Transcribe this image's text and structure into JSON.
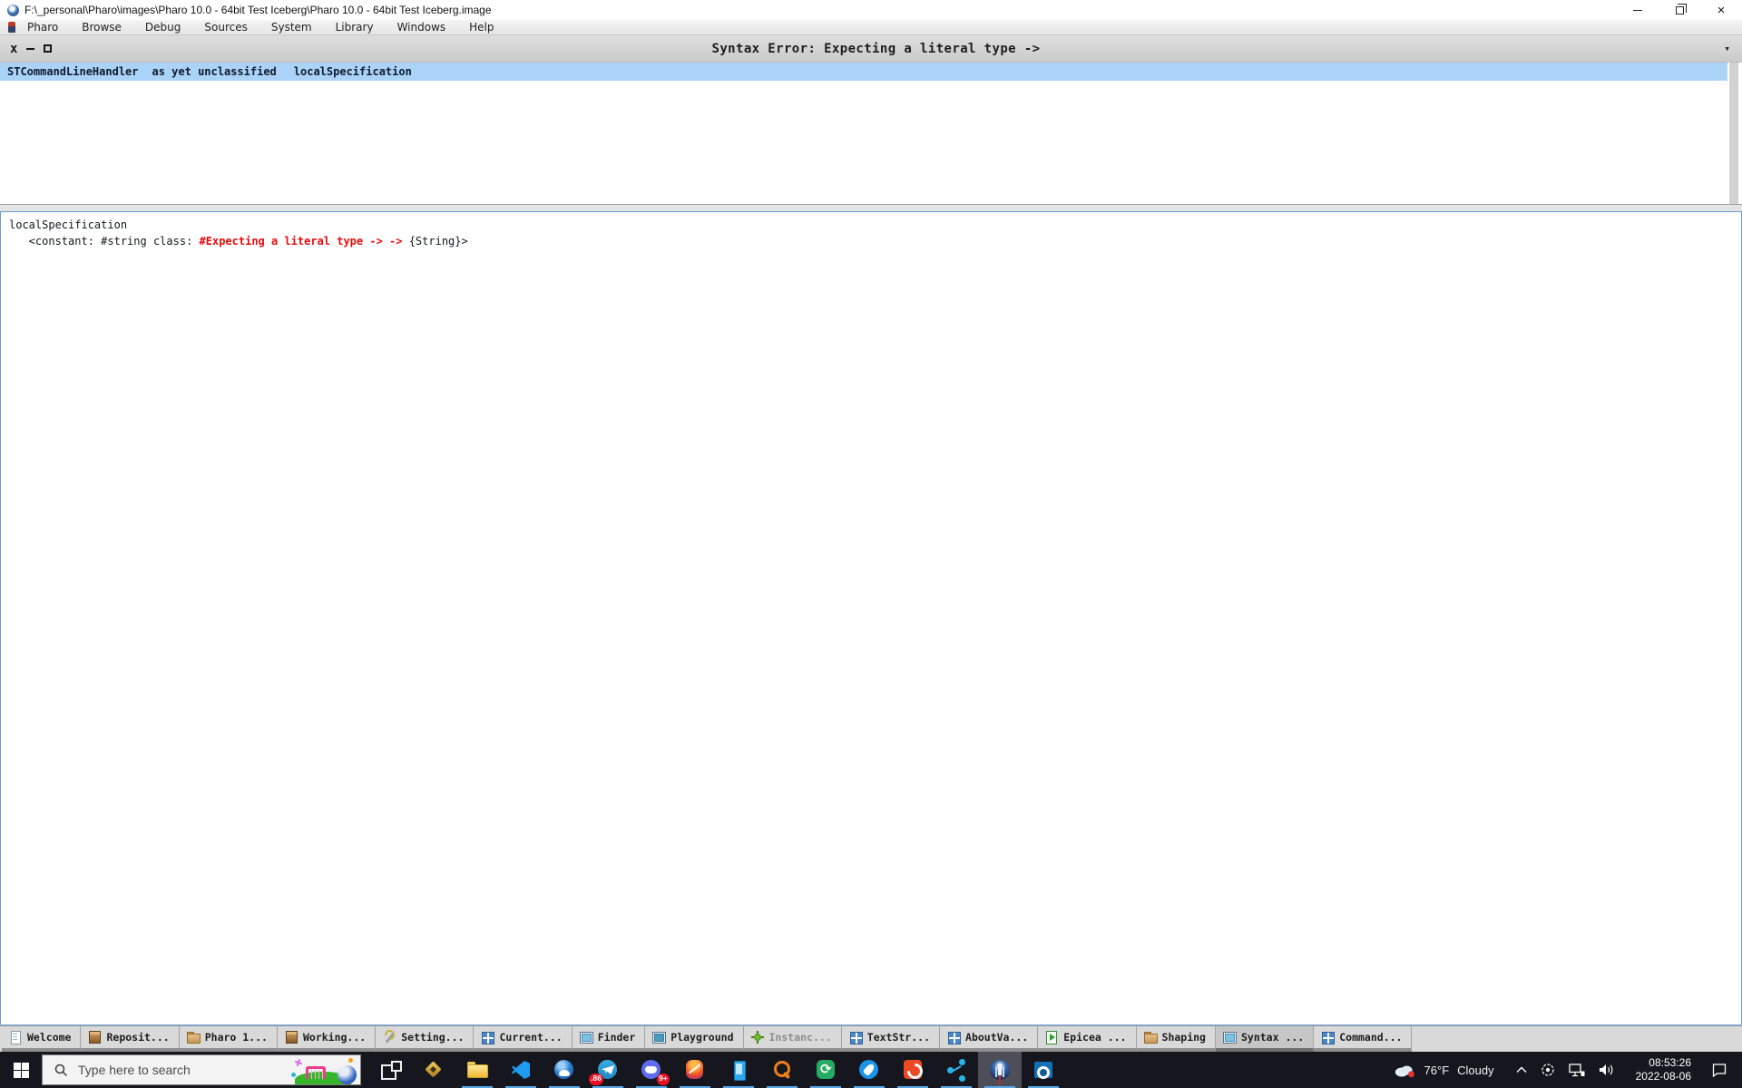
{
  "colors": {
    "selection_blue": "#abd2f7",
    "error_red": "#e50b0b",
    "code_pane_border": "#6a9ad2",
    "windows_taskbar_bg": "#16161f",
    "running_indicator_blue": "#5aa8e8",
    "badge_red": "#e81123"
  },
  "windows_titlebar": {
    "title": "F:\\_personal\\Pharo\\images\\Pharo 10.0 - 64bit Test Iceberg\\Pharo 10.0 - 64bit Test Iceberg.image"
  },
  "menu": {
    "items": [
      {
        "label": "Pharo"
      },
      {
        "label": "Browse"
      },
      {
        "label": "Debug"
      },
      {
        "label": "Sources"
      },
      {
        "label": "System"
      },
      {
        "label": "Library"
      },
      {
        "label": "Windows"
      },
      {
        "label": "Help"
      }
    ]
  },
  "syntax_window": {
    "close_glyph": "x",
    "chevron_glyph": "▾",
    "title": "Syntax Error: Expecting a literal type ->",
    "selected_row": {
      "class_name": "STCommandLineHandler",
      "protocol": "as yet unclassified",
      "selector": "localSpecification"
    },
    "code": {
      "line1": "localSpecification",
      "line2_pre": "   <constant: #string class: ",
      "line2_error": "#Expecting a literal type -> ->",
      "line2_post": " {String}>"
    }
  },
  "pharo_taskbar": {
    "buttons": [
      {
        "name": "welcome",
        "label": "Welcome",
        "icon": "welcome"
      },
      {
        "name": "repositories",
        "label": "Reposit...",
        "icon": "package"
      },
      {
        "name": "pharo-folder",
        "label": "Pharo 1...",
        "icon": "folder"
      },
      {
        "name": "working-copy",
        "label": "Working...",
        "icon": "package"
      },
      {
        "name": "settings",
        "label": "Setting...",
        "icon": "settings"
      },
      {
        "name": "current",
        "label": "Current...",
        "icon": "grid"
      },
      {
        "name": "finder",
        "label": "Finder",
        "icon": "window"
      },
      {
        "name": "playground",
        "label": "Playground",
        "icon": "playground"
      },
      {
        "name": "instance",
        "label": "Instanc...",
        "icon": "bug",
        "dimmed": true
      },
      {
        "name": "textstring",
        "label": "TextStr...",
        "icon": "grid"
      },
      {
        "name": "aboutvalue",
        "label": "AboutVa...",
        "icon": "grid"
      },
      {
        "name": "epicea",
        "label": "Epicea ...",
        "icon": "epicea"
      },
      {
        "name": "shaping",
        "label": "Shaping",
        "icon": "folder"
      },
      {
        "name": "syntax-error",
        "label": "Syntax ...",
        "icon": "window",
        "active": true
      },
      {
        "name": "command",
        "label": "Command...",
        "icon": "grid"
      }
    ]
  },
  "windows_taskbar": {
    "search_placeholder": "Type here to search",
    "app_icons": [
      {
        "name": "task-view",
        "icon": "task-view",
        "running": false
      },
      {
        "name": "compass",
        "icon": "compass",
        "running": false
      },
      {
        "name": "file-explorer",
        "icon": "explorer",
        "running": true
      },
      {
        "name": "vscode",
        "icon": "vscode",
        "running": true
      },
      {
        "name": "browser",
        "icon": "browser",
        "running": true
      },
      {
        "name": "telegram",
        "icon": "telegram",
        "running": true,
        "badge": ".86",
        "badge_side": "left"
      },
      {
        "name": "discord",
        "icon": "discord",
        "running": true,
        "badge": "9+",
        "badge_side": "right"
      },
      {
        "name": "monkey-app",
        "icon": "monkey",
        "running": true
      },
      {
        "name": "your-phone",
        "icon": "your-phone",
        "running": true
      },
      {
        "name": "search-app",
        "icon": "search-orange",
        "running": true
      },
      {
        "name": "sync-app",
        "icon": "sync",
        "running": true
      },
      {
        "name": "rocket-app",
        "icon": "rocket",
        "running": true
      },
      {
        "name": "pdf-app",
        "icon": "pdf",
        "running": true
      },
      {
        "name": "share-app",
        "icon": "molecule",
        "running": true
      },
      {
        "name": "pharo",
        "icon": "pharo",
        "running": true,
        "active": true
      },
      {
        "name": "outlook",
        "icon": "outlook",
        "running": true
      }
    ],
    "tray": {
      "temperature": "76°F",
      "condition": "Cloudy",
      "time": "08:53:26",
      "date": "2022-08-06",
      "icons": [
        "weather-cloud",
        "chevron-up",
        "people",
        "network",
        "volume",
        "action-center"
      ]
    }
  }
}
